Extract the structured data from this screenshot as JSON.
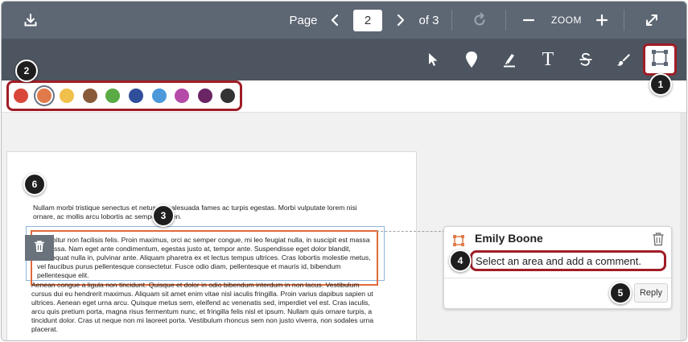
{
  "topbar": {
    "download_icon": "download-icon",
    "page_label": "Page",
    "page_number": "2",
    "of_label": "of 3",
    "zoom_label": "ZOOM",
    "rotate_icon": "rotate-icon",
    "fullscreen_icon": "expand-icon"
  },
  "tools": [
    "cursor-icon",
    "pin-icon",
    "highlight-icon",
    "text-icon",
    "strikethrough-icon",
    "draw-icon",
    "area-icon"
  ],
  "tool_text_glyph": "T",
  "colors": {
    "swatches": [
      "#d9473a",
      "#e07a4a",
      "#f0c04c",
      "#8a5b3a",
      "#5aaa45",
      "#2f4f9b",
      "#4c98db",
      "#b64aa8",
      "#6b2565",
      "#333333"
    ],
    "selected_index": 1,
    "accent": "#a01d26"
  },
  "document": {
    "p1": "Nullam morbi tristique senectus et netus et malesuada fames ac turpis egestas. Morbi vulputate lorem nisi ornare, ac mollis arcu lobortis ac semper sapien.",
    "p2": "Curabitur non facilisis felis. Proin maximus, orci ac semper congue, mi leo feugiat nulla, in suscipit est massa id massa. Nam eget ante condimentum, egestas justo at, tempor ante. Suspendisse eget dolor blandit, consequat nulla in, pulvinar ante. Aliquam pharetra ex et lectus tempus ultrices. Cras lobortis molestie metus, vel faucibus purus pellentesque consectetur. Fusce odio diam, pellentesque et mauris id, bibendum pellentesque elit.",
    "p3": "Aenean congue a ligula non tincidunt. Quisque et dolor in odio bibendum interdum in non lacus. Vestibulum cursus dui eu hendrerit maximus. Aliquam sit amet enim vitae nisl iaculis fringilla. Proin varius dapibus sapien ut ultrices. Aenean eget urna arcu. Quisque metus sem, eleifend ac venenatis sed, imperdiet vel est. Cras iaculis, arcu quis pretium porta, magna risus fermentum nunc, et fringilla felis nisl et ipsum. Nullam quis ornare turpis, a tincidunt dolor. Cras ut neque non mi laoreet porta. Vestibulum rhoncus sem non justo viverra, non sodales urna placerat."
  },
  "comment": {
    "author": "Emily Boone",
    "text": "Select an area and add a comment.",
    "reply_label": "Reply"
  },
  "callouts": [
    "1",
    "2",
    "3",
    "4",
    "5",
    "6"
  ]
}
